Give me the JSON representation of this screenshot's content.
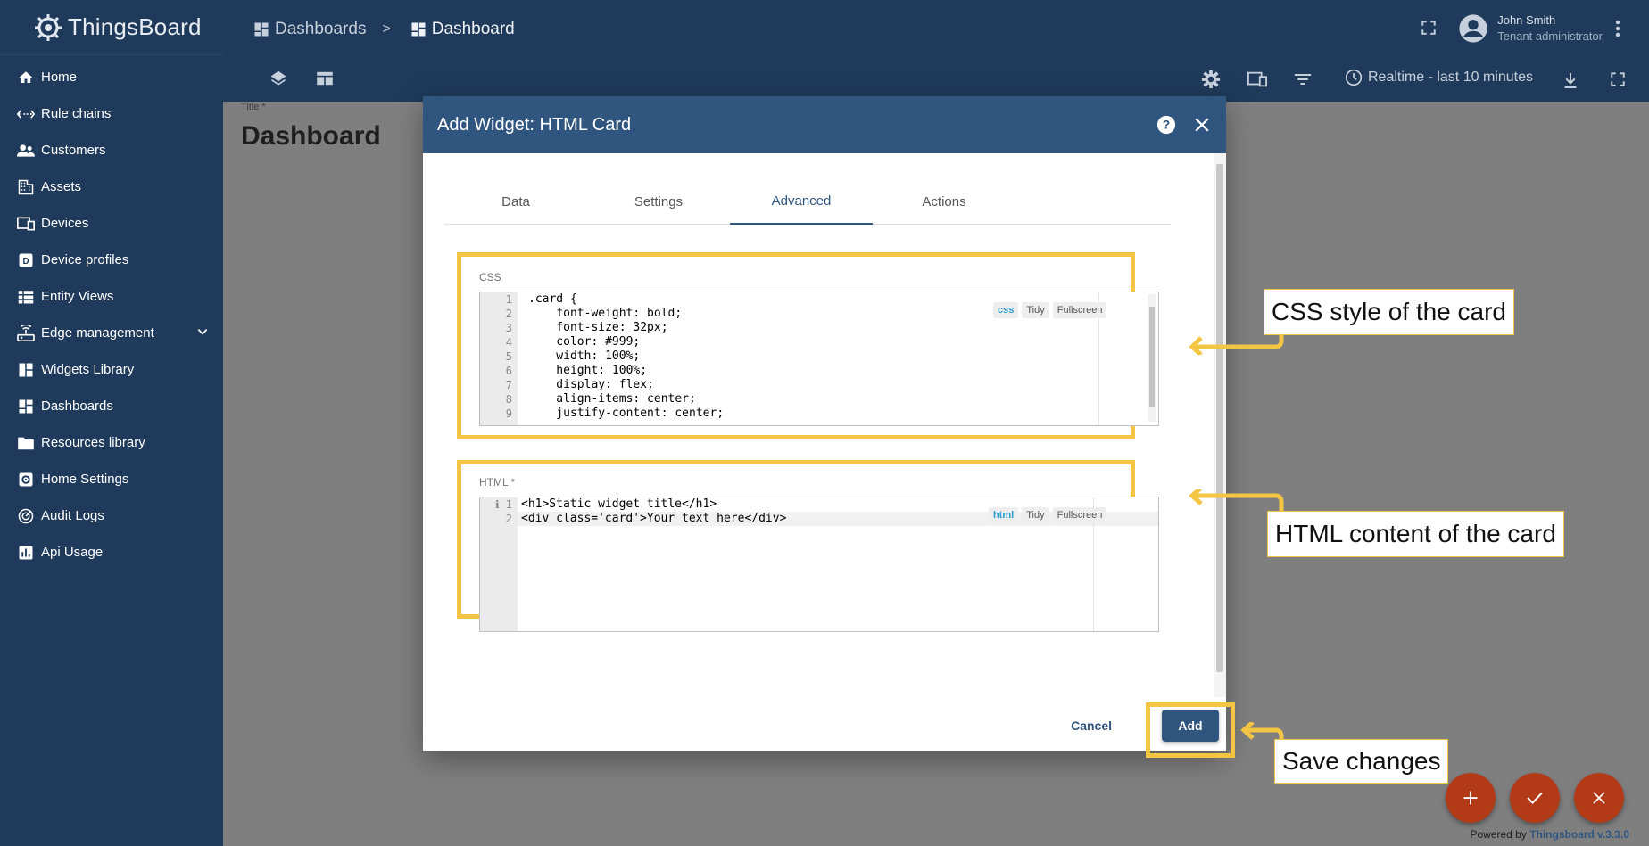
{
  "app": {
    "name": "ThingsBoard"
  },
  "sidebar": {
    "items": [
      {
        "label": "Home",
        "icon": "home-icon"
      },
      {
        "label": "Rule chains",
        "icon": "rule-chains-icon"
      },
      {
        "label": "Customers",
        "icon": "customers-icon"
      },
      {
        "label": "Assets",
        "icon": "assets-icon"
      },
      {
        "label": "Devices",
        "icon": "devices-icon"
      },
      {
        "label": "Device profiles",
        "icon": "device-profiles-icon"
      },
      {
        "label": "Entity Views",
        "icon": "entity-views-icon"
      },
      {
        "label": "Edge management",
        "icon": "edge-icon"
      },
      {
        "label": "Widgets Library",
        "icon": "widgets-icon"
      },
      {
        "label": "Dashboards",
        "icon": "dashboards-icon"
      },
      {
        "label": "Resources library",
        "icon": "folder-icon"
      },
      {
        "label": "Home Settings",
        "icon": "settings-icon"
      },
      {
        "label": "Audit Logs",
        "icon": "audit-icon"
      },
      {
        "label": "Api Usage",
        "icon": "chart-icon"
      }
    ]
  },
  "header": {
    "breadcrumb": {
      "parent": "Dashboards",
      "separator": ">",
      "current": "Dashboard"
    },
    "user": {
      "name": "John Smith",
      "role": "Tenant administrator"
    },
    "timewindow": "Realtime - last 10 minutes"
  },
  "dashboard": {
    "title_label": "Title *",
    "title": "Dashboard"
  },
  "dialog": {
    "title": "Add Widget: HTML Card",
    "tabs": [
      "Data",
      "Settings",
      "Advanced",
      "Actions"
    ],
    "active_tab": "Advanced",
    "css": {
      "label": "CSS",
      "mode": "css",
      "tidy": "Tidy",
      "fullscreen": "Fullscreen",
      "lines": [
        ".card {",
        "    font-weight: bold;",
        "    font-size: 32px;",
        "    color: #999;",
        "    width: 100%;",
        "    height: 100%;",
        "    display: flex;",
        "    align-items: center;",
        "    justify-content: center;"
      ]
    },
    "html": {
      "label": "HTML *",
      "mode": "html",
      "tidy": "Tidy",
      "fullscreen": "Fullscreen",
      "lines": [
        "<h1>Static widget title</h1>",
        "<div class='card'>Your text here</div>"
      ]
    },
    "cancel_label": "Cancel",
    "add_label": "Add"
  },
  "callouts": {
    "css": "CSS style of the card",
    "html": "HTML content of the card",
    "save": "Save changes"
  },
  "footer": {
    "powered_prefix": "Powered by",
    "powered_brand": "Thingsboard v.3.3.0"
  },
  "colors": {
    "primary": "#305680",
    "sidebar": "#1f3a5a",
    "highlight": "#f4c542",
    "fab": "#b23a17"
  }
}
